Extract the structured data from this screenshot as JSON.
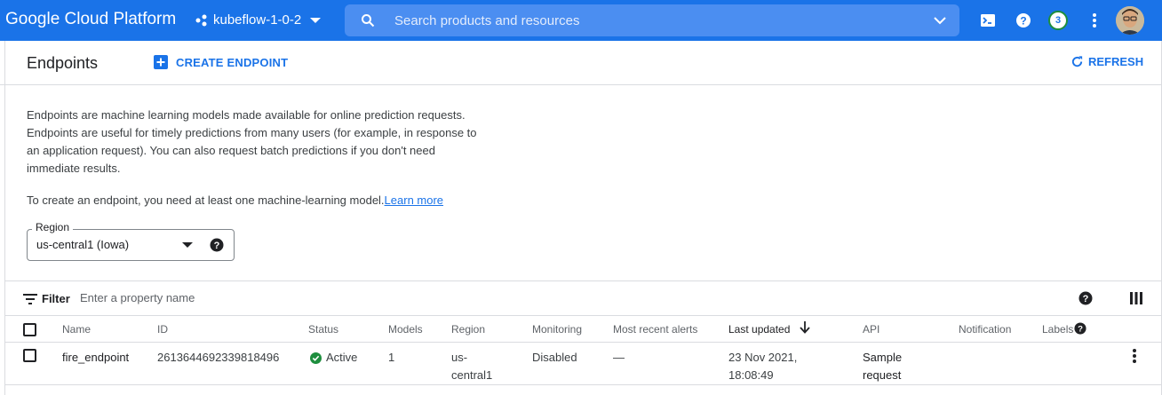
{
  "topbar": {
    "brand": "Google Cloud Platform",
    "project": "kubeflow-1-0-2",
    "search_placeholder": "Search products and resources",
    "notifications_count": "3",
    "colors": {
      "bar": "#1a73e8",
      "search": "#4b8ef1"
    },
    "icons": [
      "project-dots-icon",
      "dropdown-caret-icon",
      "search-icon",
      "chevron-down-icon",
      "cloud-shell-icon",
      "help-icon",
      "more-vert-icon",
      "avatar"
    ]
  },
  "header": {
    "title": "Endpoints",
    "create_label": "CREATE ENDPOINT",
    "refresh_label": "REFRESH"
  },
  "description": {
    "line1": "Endpoints are machine learning models made available for online prediction requests.",
    "line2": "Endpoints are useful for timely predictions from many users (for example, in response to",
    "line3": "an application request). You can also request batch predictions if you don't need",
    "line4": "immediate results.",
    "hint": "To create an endpoint, you need at least one machine-learning model.",
    "learn_more": "Learn more"
  },
  "region": {
    "label": "Region",
    "value": "us-central1 (Iowa)"
  },
  "filter": {
    "label": "Filter",
    "placeholder": "Enter a property name"
  },
  "table": {
    "headers": {
      "name": "Name",
      "id": "ID",
      "status": "Status",
      "models": "Models",
      "region": "Region",
      "monitoring": "Monitoring",
      "alerts": "Most recent alerts",
      "updated": "Last updated",
      "api": "API",
      "notification": "Notification",
      "labels": "Labels"
    },
    "rows": [
      {
        "name": "fire_endpoint",
        "id": "2613644692339818496",
        "status": "Active",
        "models": "1",
        "region_l1": "us-",
        "region_l2": "central1",
        "monitoring": "Disabled",
        "alerts": "—",
        "updated_l1": "23 Nov 2021,",
        "updated_l2": "18:08:49",
        "api_l1": "Sample",
        "api_l2": "request"
      }
    ]
  }
}
